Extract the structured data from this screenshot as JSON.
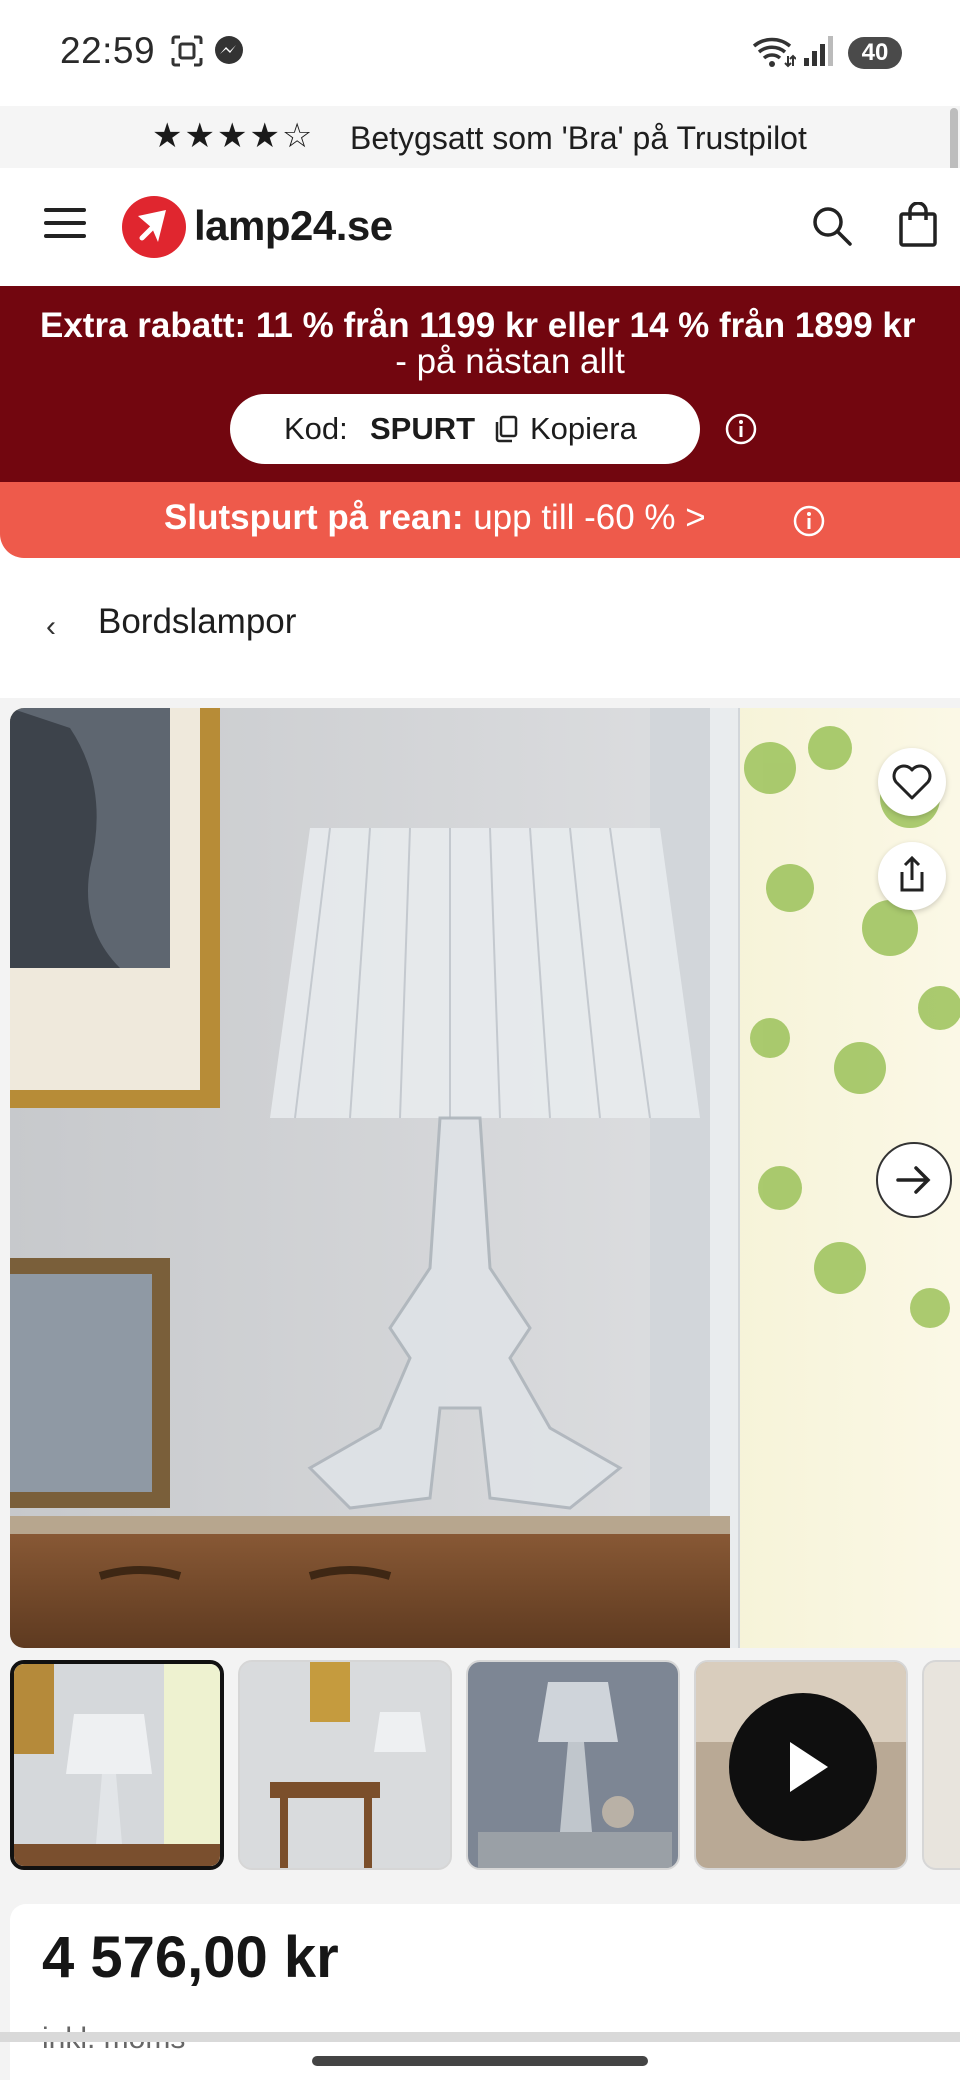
{
  "status_bar": {
    "time": "22:59",
    "battery": "40"
  },
  "trust": {
    "stars": "★★★★☆",
    "text": "Betygsatt som 'Bra' på Trustpilot"
  },
  "header": {
    "logo": "lamp24.se"
  },
  "promo": {
    "line1": "Extra rabatt: 11 % från 1199 kr eller 14 % från 1899 kr",
    "line2": "- på nästan allt",
    "code_label": "Kod:",
    "code_value": "SPURT",
    "copy_label": "Kopiera"
  },
  "sale": {
    "bold": "Slutspurt på rean:",
    "rest": " upp till -60 % >"
  },
  "breadcrumb": {
    "label": "Bordslampor"
  },
  "product": {
    "price": "4 576,00 kr",
    "vat": "inkl. moms"
  },
  "colors": {
    "promo_bg": "#72060f",
    "sale_bg": "#ee5a4b",
    "brand_red": "#e0262f"
  }
}
